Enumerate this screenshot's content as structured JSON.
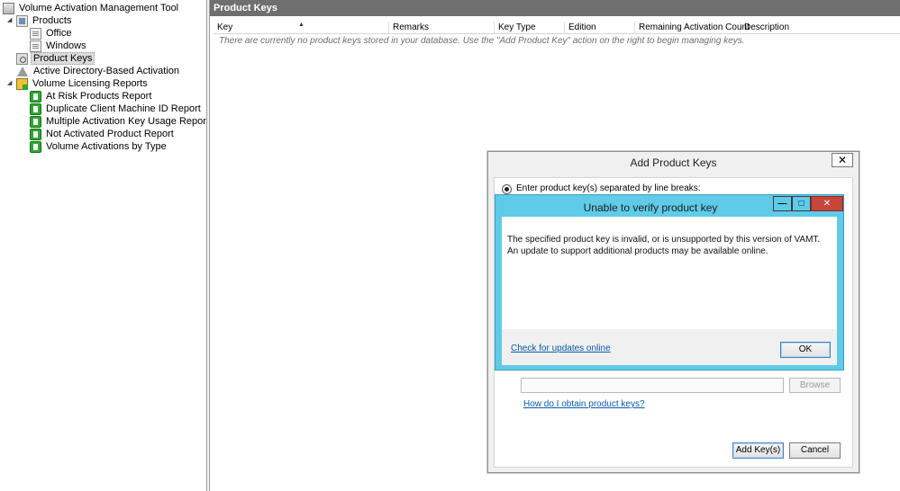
{
  "tree": {
    "root": "Volume Activation Management Tool",
    "products": "Products",
    "office": "Office",
    "windows": "Windows",
    "product_keys": "Product Keys",
    "ad_activation": "Active Directory-Based Activation",
    "vlr": "Volume Licensing Reports",
    "reports": [
      "At Risk Products Report",
      "Duplicate Client Machine ID Report",
      "Multiple Activation Key Usage Report",
      "Not Activated Product Report",
      "Volume Activations by Type"
    ],
    "expanded_glyph": "◢"
  },
  "main": {
    "title": "Product Keys",
    "columns": [
      "Key",
      "Remarks",
      "Key Type",
      "Edition",
      "Remaining Activation Count",
      "Description"
    ],
    "sort_arrow": "▲",
    "empty_message": "There are currently no product keys stored in your database. Use the \"Add Product Key\" action on the right to begin managing keys."
  },
  "add_dialog": {
    "title": "Add Product Keys",
    "close": "✕",
    "radio_label": "Enter product key(s) separated by line breaks:",
    "browse": "Browse",
    "how_link": "How do I obtain product keys?",
    "add_button": "Add Key(s)",
    "cancel_button": "Cancel"
  },
  "error_dialog": {
    "title": "Unable to verify product key",
    "min": "—",
    "max": "□",
    "close": "✕",
    "message_line1": "The specified product key is invalid, or is unsupported by this version of VAMT.",
    "message_line2": "An update to support additional products may be available online.",
    "link": "Check for updates online",
    "ok": "OK"
  },
  "colors": {
    "title_bar": "#6f6f6f",
    "error_frame": "#5fcbe9",
    "close_red": "#c7463a",
    "link_blue": "#0c5aa6"
  }
}
